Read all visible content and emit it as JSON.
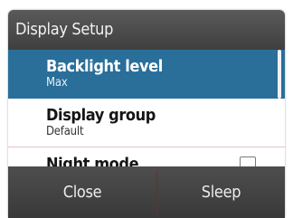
{
  "dialog": {
    "title": "Display Setup"
  },
  "items": [
    {
      "label": "Backlight level",
      "value": "Max",
      "selected": true
    },
    {
      "label": "Display group",
      "value": "Default",
      "selected": false
    },
    {
      "label": "Night mode",
      "value": "",
      "selected": false,
      "control": "checkbox",
      "checked": false
    }
  ],
  "footer": {
    "close_label": "Close",
    "sleep_label": "Sleep"
  },
  "colors": {
    "selection": "#2a6e9a",
    "titlebar": "#4a4a4a",
    "footer": "#444444"
  }
}
